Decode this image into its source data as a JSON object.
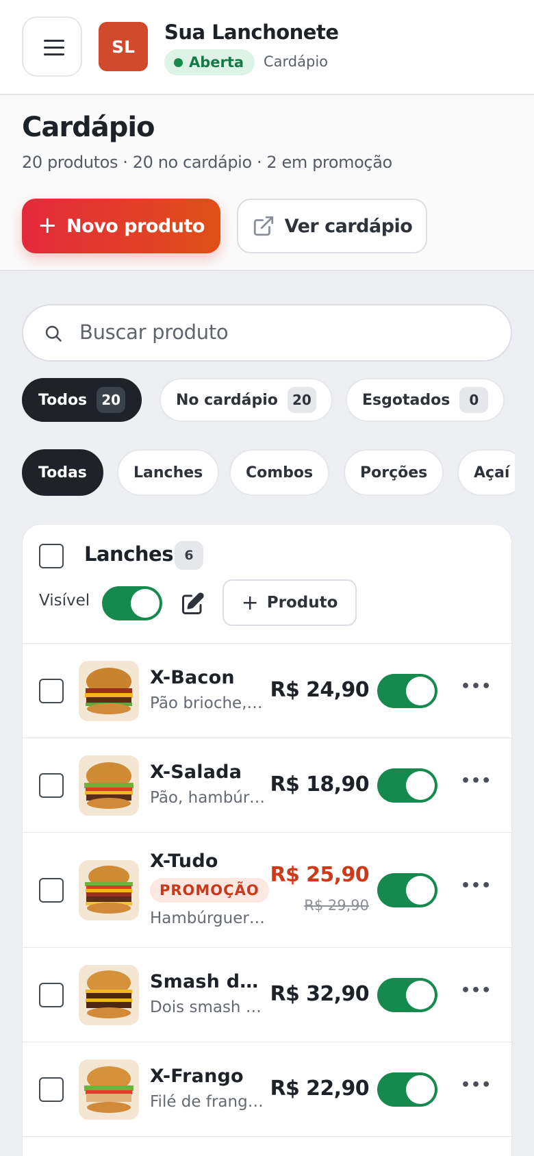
{
  "topbar": {
    "avatar_initials": "SL",
    "store_name": "Sua Lanchonete",
    "status": "Aberta",
    "section": "Cardápio"
  },
  "header": {
    "title": "Cardápio",
    "stats": "20 produtos · 20 no cardápio · 2 em promoção",
    "new_product_label": "Novo produto",
    "view_menu_label": "Ver cardápio"
  },
  "search": {
    "placeholder": "Buscar produto"
  },
  "status_filters": [
    {
      "label": "Todos",
      "count": "20"
    },
    {
      "label": "No cardápio",
      "count": "20"
    },
    {
      "label": "Esgotados",
      "count": "0"
    }
  ],
  "category_filters": [
    "Todas",
    "Lanches",
    "Combos",
    "Porções",
    "Açaí"
  ],
  "group": {
    "title": "Lanches",
    "count": "6",
    "visible_label": "Visível",
    "visible": true,
    "add_product_label": "Produto"
  },
  "products": [
    {
      "name": "X-Bacon",
      "description": "Pão brioche, hambúrguer, bacon e queijo",
      "price": "R$ 24,90",
      "available": true
    },
    {
      "name": "X-Salada",
      "description": "Pão, hambúrguer, alface e tomate",
      "price": "R$ 18,90",
      "available": true
    },
    {
      "name": "X-Tudo",
      "badge": "PROMOÇÃO",
      "description": "Hambúrguer com tudo",
      "price": "R$ 25,90",
      "old_price": "R$ 29,90",
      "available": true
    },
    {
      "name": "Smash duplo",
      "description": "Dois smash de carne",
      "price": "R$ 32,90",
      "available": true
    },
    {
      "name": "X-Frango",
      "description": "Filé de frango grelhado",
      "price": "R$ 22,90",
      "available": true
    }
  ],
  "colors": {
    "accent_red": "#e3293b",
    "status_green": "#168a4e",
    "promo_red": "#cd3a1a"
  }
}
